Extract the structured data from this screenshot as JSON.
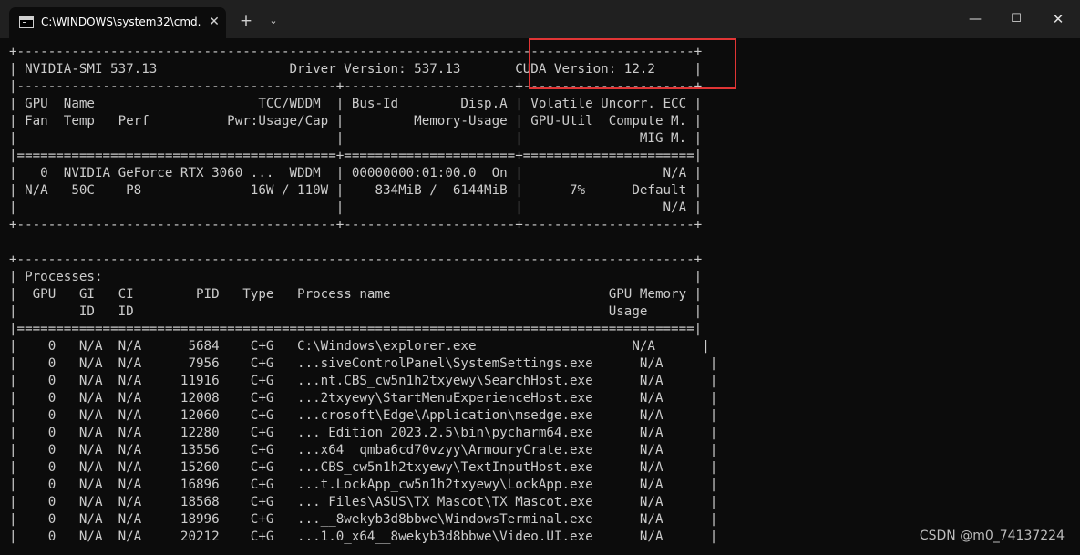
{
  "window": {
    "tab_title": "C:\\WINDOWS\\system32\\cmd.",
    "tab_close_glyph": "✕",
    "new_tab_glyph": "+",
    "dropdown_glyph": "⌄",
    "minimize_glyph": "—",
    "maximize_glyph": "☐",
    "close_glyph": "✕"
  },
  "terminal": {
    "lines": [
      "+---------------------------------------------------------------------------------------+",
      "| NVIDIA-SMI 537.13                 Driver Version: 537.13       CUDA Version: 12.2     |",
      "|-----------------------------------------+----------------------+----------------------+",
      "| GPU  Name                     TCC/WDDM  | Bus-Id        Disp.A | Volatile Uncorr. ECC |",
      "| Fan  Temp   Perf          Pwr:Usage/Cap |         Memory-Usage | GPU-Util  Compute M. |",
      "|                                         |                      |               MIG M. |",
      "|=========================================+======================+======================|",
      "|   0  NVIDIA GeForce RTX 3060 ...  WDDM  | 00000000:01:00.0  On |                  N/A |",
      "| N/A   50C    P8              16W / 110W |    834MiB /  6144MiB |      7%      Default |",
      "|                                         |                      |                  N/A |",
      "+-----------------------------------------+----------------------+----------------------+",
      "",
      "+---------------------------------------------------------------------------------------+",
      "| Processes:                                                                            |",
      "|  GPU   GI   CI        PID   Type   Process name                            GPU Memory |",
      "|        ID   ID                                                             Usage      |",
      "|=======================================================================================|",
      "|    0   N/A  N/A      5684    C+G   C:\\Windows\\explorer.exe                    N/A      |",
      "|    0   N/A  N/A      7956    C+G   ...siveControlPanel\\SystemSettings.exe      N/A      |",
      "|    0   N/A  N/A     11916    C+G   ...nt.CBS_cw5n1h2txyewy\\SearchHost.exe      N/A      |",
      "|    0   N/A  N/A     12008    C+G   ...2txyewy\\StartMenuExperienceHost.exe      N/A      |",
      "|    0   N/A  N/A     12060    C+G   ...crosoft\\Edge\\Application\\msedge.exe      N/A      |",
      "|    0   N/A  N/A     12280    C+G   ... Edition 2023.2.5\\bin\\pycharm64.exe      N/A      |",
      "|    0   N/A  N/A     13556    C+G   ...x64__qmba6cd70vzyy\\ArmouryCrate.exe      N/A      |",
      "|    0   N/A  N/A     15260    C+G   ...CBS_cw5n1h2txyewy\\TextInputHost.exe      N/A      |",
      "|    0   N/A  N/A     16896    C+G   ...t.LockApp_cw5n1h2txyewy\\LockApp.exe      N/A      |",
      "|    0   N/A  N/A     18568    C+G   ... Files\\ASUS\\TX Mascot\\TX Mascot.exe      N/A      |",
      "|    0   N/A  N/A     18996    C+G   ...__8wekyb3d8bbwe\\WindowsTerminal.exe      N/A      |",
      "|    0   N/A  N/A     20212    C+G   ...1.0_x64__8wekyb3d8bbwe\\Video.UI.exe      N/A      |"
    ]
  },
  "annotation": {
    "color": "#e03535"
  },
  "watermark": {
    "text": "CSDN @m0_74137224"
  }
}
